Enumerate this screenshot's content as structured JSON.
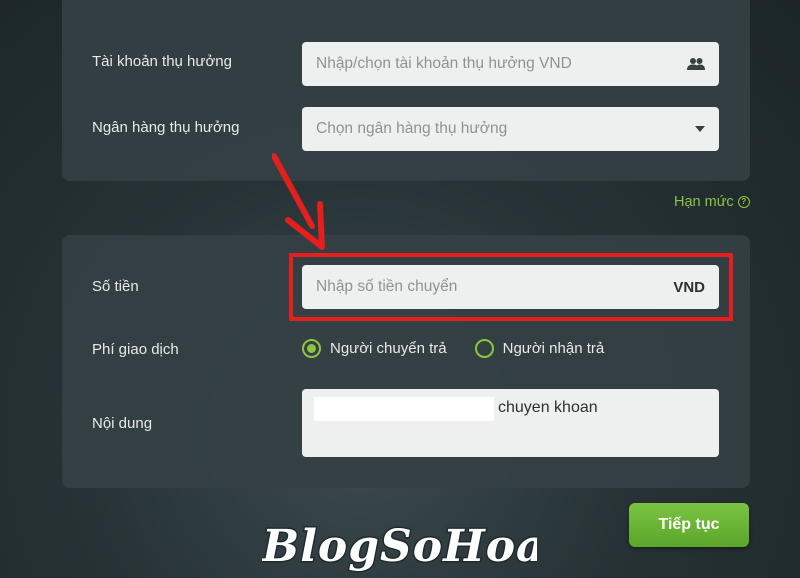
{
  "beneficiary": {
    "account_label": "Tài khoản thụ hưởng",
    "account_placeholder": "Nhập/chọn tài khoản thụ hưởng VND",
    "account_icon": "contacts-icon",
    "bank_label": "Ngân hàng thụ hưởng",
    "bank_placeholder": "Chọn ngân hàng thụ hưởng",
    "bank_icon": "caret-down-icon"
  },
  "limit_link": {
    "label": "Hạn mức",
    "icon": "help-icon"
  },
  "transfer": {
    "amount_label": "Số tiền",
    "amount_placeholder": "Nhập số tiền chuyển",
    "amount_unit": "VND",
    "fee_label": "Phí giao dịch",
    "fee_options": [
      {
        "label": "Người chuyển trả",
        "selected": true
      },
      {
        "label": "Người nhận trả",
        "selected": false
      }
    ],
    "content_label": "Nội dung",
    "content_value": "chuyen khoan"
  },
  "continue_label": "Tiếp tục",
  "watermark": "BlogSoHoa",
  "colors": {
    "accent": "#8cc63f",
    "annotation": "#e51e1e",
    "button": "#6cb535"
  }
}
